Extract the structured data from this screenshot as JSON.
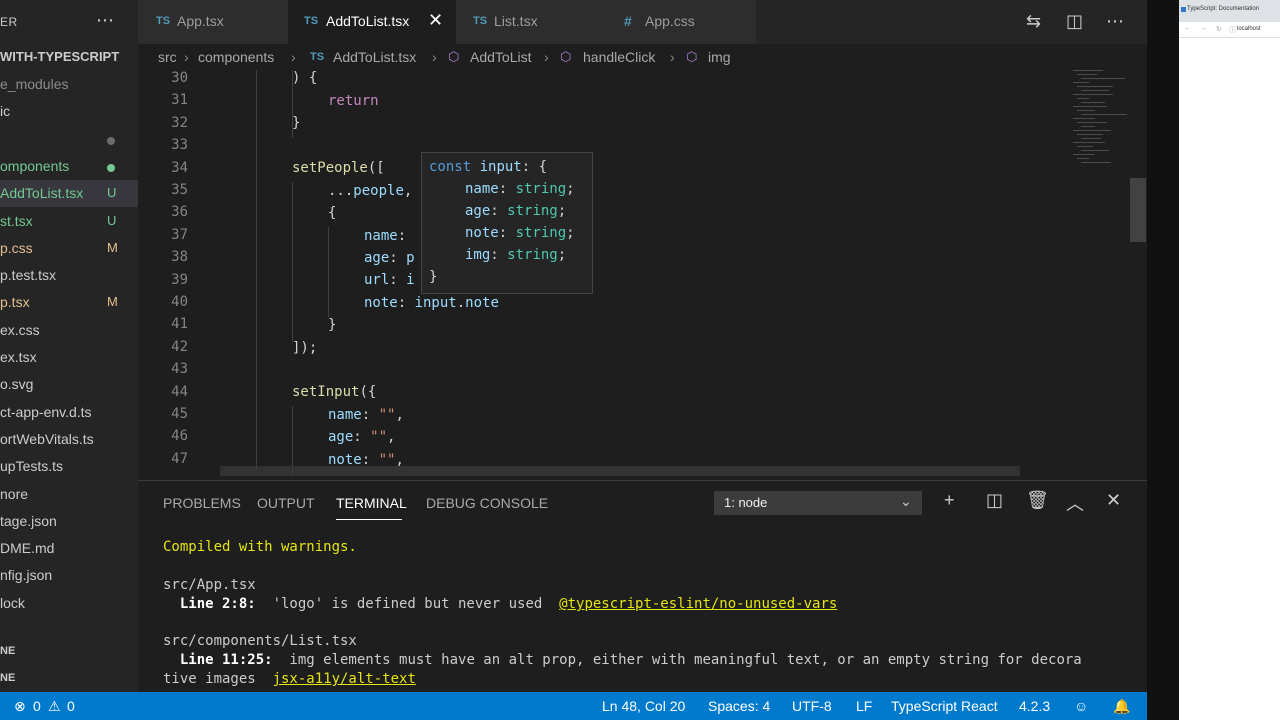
{
  "sidebar": {
    "header_title": "ER",
    "more_icon": "ellipsis-icon",
    "project": "WITH-TYPESCRIPT",
    "items": [
      {
        "label": "e_modules",
        "color": "#8c8c8c",
        "badge": ""
      },
      {
        "label": "ic",
        "color": "#cccccc",
        "badge": ""
      },
      {
        "label": "",
        "color": "#cccccc",
        "badge": "",
        "dot": "#6b6b6b"
      },
      {
        "label": "omponents",
        "color": "#73c991",
        "badge": "",
        "dot": "#73c991"
      },
      {
        "label": "AddToList.tsx",
        "color": "#73c991",
        "badge": "U",
        "selected": true
      },
      {
        "label": "st.tsx",
        "color": "#73c991",
        "badge": "U"
      },
      {
        "label": "p.css",
        "color": "#e2c08d",
        "badge": "M"
      },
      {
        "label": "p.test.tsx",
        "color": "#cccccc",
        "badge": ""
      },
      {
        "label": "p.tsx",
        "color": "#e2c08d",
        "badge": "M"
      },
      {
        "label": "ex.css",
        "color": "#cccccc",
        "badge": ""
      },
      {
        "label": "ex.tsx",
        "color": "#cccccc",
        "badge": ""
      },
      {
        "label": "o.svg",
        "color": "#cccccc",
        "badge": ""
      },
      {
        "label": "ct-app-env.d.ts",
        "color": "#cccccc",
        "badge": ""
      },
      {
        "label": "ortWebVitals.ts",
        "color": "#cccccc",
        "badge": ""
      },
      {
        "label": "upTests.ts",
        "color": "#cccccc",
        "badge": ""
      },
      {
        "label": "nore",
        "color": "#cccccc",
        "badge": ""
      },
      {
        "label": "tage.json",
        "color": "#cccccc",
        "badge": ""
      },
      {
        "label": "DME.md",
        "color": "#cccccc",
        "badge": ""
      },
      {
        "label": "nfig.json",
        "color": "#cccccc",
        "badge": ""
      },
      {
        "label": "lock",
        "color": "#cccccc",
        "badge": ""
      }
    ],
    "section_outline": "NE",
    "section_timeline": "NE"
  },
  "tabs": [
    {
      "icon": "TS",
      "label": "App.tsx",
      "active": false
    },
    {
      "icon": "TS",
      "label": "AddToList.tsx",
      "active": true,
      "close_icon": "close-icon"
    },
    {
      "icon": "TS",
      "label": "List.tsx",
      "active": false
    },
    {
      "icon": "#",
      "label": "App.css",
      "active": false
    }
  ],
  "editor_actions": [
    "compare-changes-icon",
    "split-editor-icon",
    "more-actions-icon"
  ],
  "breadcrumb": {
    "items": [
      "src",
      "components",
      "AddToList.tsx",
      "AddToList",
      "handleClick",
      "img"
    ]
  },
  "editor": {
    "lines": [
      30,
      31,
      32,
      33,
      34,
      35,
      36,
      37,
      38,
      39,
      40,
      41,
      42,
      43,
      44,
      45,
      46,
      47
    ],
    "hover": {
      "line1": "const input: {",
      "fields": [
        {
          "name": "name",
          "type": "string"
        },
        {
          "name": "age",
          "type": "string"
        },
        {
          "name": "note",
          "type": "string"
        },
        {
          "name": "img",
          "type": "string"
        }
      ],
      "close": "}"
    }
  },
  "panel": {
    "tabs": [
      "PROBLEMS",
      "OUTPUT",
      "TERMINAL",
      "DEBUG CONSOLE"
    ],
    "active_tab": "TERMINAL",
    "terminal_select": "1: node",
    "actions": [
      "add-terminal-icon",
      "split-terminal-icon",
      "trash-icon",
      "maximize-panel-icon",
      "close-panel-icon"
    ],
    "terminal": {
      "compiled": "Compiled with warnings.",
      "file1": "src/App.tsx",
      "file1_line": "Line 2:8:",
      "file1_msg": "  'logo' is defined but never used  ",
      "file1_rule": "@typescript-eslint/no-unused-vars",
      "file2": "src/components/List.tsx",
      "file2_line": "Line 11:25:",
      "file2_msg": "  img elements must have an alt prop, either with meaningful text, or an empty string for decora",
      "file2_cont": "tive images  ",
      "file2_rule": "jsx-a11y/alt-text"
    }
  },
  "statusbar": {
    "errors": "0",
    "warnings": "0",
    "position": "Ln 48, Col 20",
    "spaces": "Spaces: 4",
    "encoding": "UTF-8",
    "eol": "LF",
    "language": "TypeScript React",
    "version": "4.2.3"
  },
  "browser": {
    "tab_title": "TypeScript: Documentation",
    "url": "localhost"
  }
}
